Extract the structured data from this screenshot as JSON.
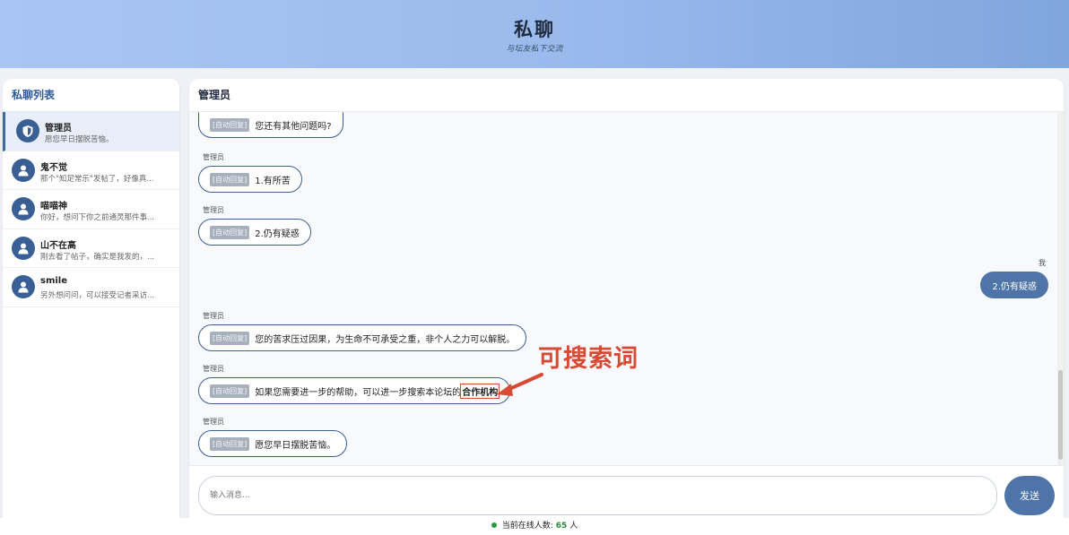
{
  "header": {
    "title": "私聊",
    "subtitle": "与坛友私下交流"
  },
  "sidebar": {
    "title": "私聊列表",
    "conversations": [
      {
        "name": "管理员",
        "preview": "愿您早日摆脱苦恼。",
        "icon": "shield-icon"
      },
      {
        "name": "鬼不觉",
        "preview": "那个\"知足常乐\"发帖了，好像真...",
        "icon": "user-icon"
      },
      {
        "name": "喵喵神",
        "preview": "你好，想问下你之前通灵那件事...",
        "icon": "user-icon"
      },
      {
        "name": "山不在高",
        "preview": "刚去看了帖子，确实是我发的，...",
        "icon": "user-icon"
      },
      {
        "name": "smile",
        "preview": "另外想问问，可以接受记者采访...",
        "icon": "user-icon"
      }
    ]
  },
  "chat": {
    "title": "管理员",
    "auto_tag": "[自动回复]",
    "messages": [
      {
        "sender": "",
        "text": "您还有其他问题吗?"
      },
      {
        "sender": "管理员",
        "text": "1.有所苦"
      },
      {
        "sender": "管理员",
        "text": "2.仍有疑惑"
      },
      {
        "sender": "我",
        "text": "2.仍有疑惑"
      },
      {
        "sender": "管理员",
        "text": "您的苦求压过因果，为生命不可承受之重，非个人之力可以解脱。"
      },
      {
        "sender": "管理员",
        "text": "如果您需要进一步的帮助，可以进一步搜索本论坛的",
        "highlight": "合作机构"
      },
      {
        "sender": "管理员",
        "text": "愿您早日摆脱苦恼。"
      }
    ],
    "input_placeholder": "输入消息...",
    "send_label": "发送"
  },
  "annotation": {
    "text": "可搜索词",
    "color": "#d64b33"
  },
  "footer": {
    "prefix": "当前在线人数:",
    "count": "65",
    "unit": "人"
  },
  "colors": {
    "accent": "#3a5f94",
    "online": "#2a9a3e"
  }
}
